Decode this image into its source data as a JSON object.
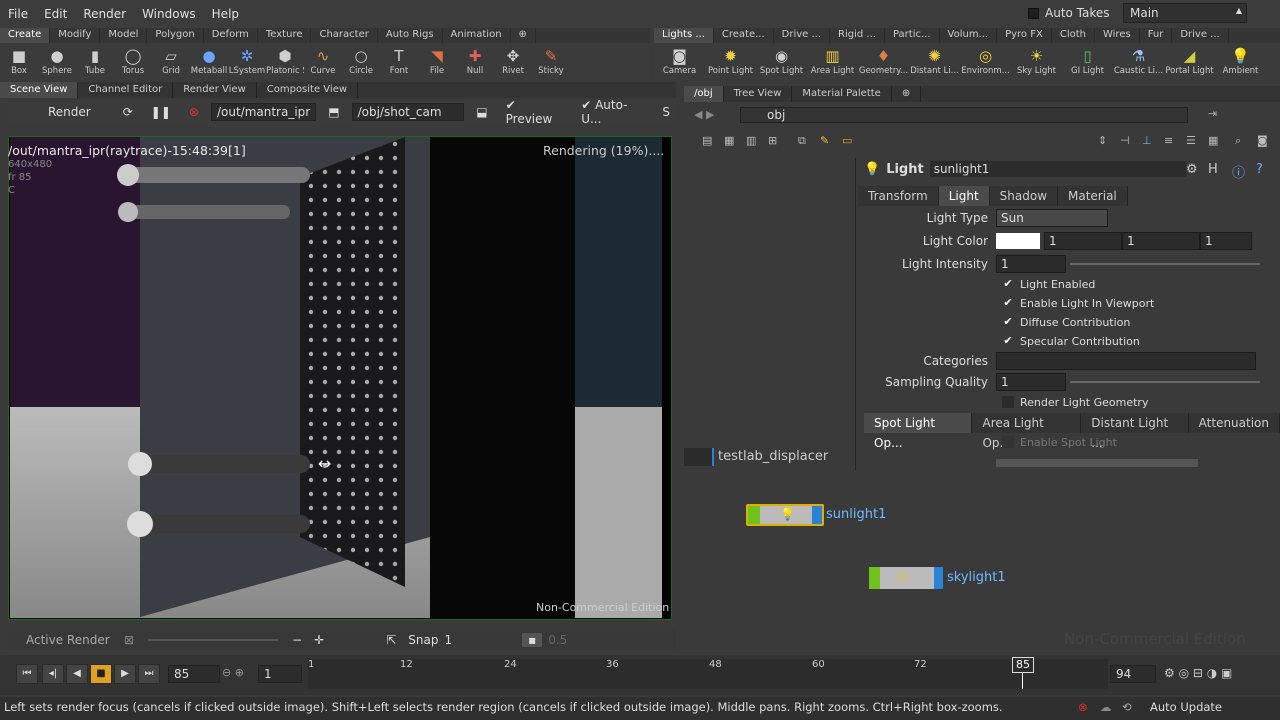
{
  "menubar": {
    "items": [
      "File",
      "Edit",
      "Render",
      "Windows",
      "Help"
    ],
    "auto_takes": "Auto Takes",
    "desktop": "Main"
  },
  "shelf_left": {
    "tabs": [
      "Create",
      "Modify",
      "Model",
      "Polygon",
      "Deform",
      "Texture",
      "Character",
      "Auto Rigs",
      "Animation"
    ],
    "tools": [
      "Box",
      "Sphere",
      "Tube",
      "Torus",
      "Grid",
      "Metaball",
      "LSystem",
      "Platonic S...",
      "Curve",
      "Circle",
      "Font",
      "File",
      "Null",
      "Rivet",
      "Sticky"
    ]
  },
  "shelf_right": {
    "tabs": [
      "Lights ...",
      "Create...",
      "Drive ...",
      "Rigid ...",
      "Partic...",
      "Volum...",
      "Pyro FX",
      "Cloth",
      "Wires",
      "Fur",
      "Drive ..."
    ],
    "tools": [
      "Camera",
      "Point Light",
      "Spot Light",
      "Area Light",
      "Geometry...",
      "Distant Li...",
      "Environm...",
      "Sky Light",
      "GI Light",
      "Caustic Li...",
      "Portal Light",
      "Ambient"
    ]
  },
  "left_tabs": [
    "Scene View",
    "Channel Editor",
    "Render View",
    "Composite View"
  ],
  "right_tabs": [
    "/obj",
    "Tree View",
    "Material Palette"
  ],
  "render_toolbar": {
    "render": "Render",
    "driver": "/out/mantra_ipr",
    "camera": "/obj/shot_cam",
    "preview": "Preview",
    "auto_update": "Auto-U...",
    "extra": "S"
  },
  "viewport": {
    "title": "/out/mantra_ipr(raytrace)-15:48:39[1]",
    "res": "640x480",
    "frame": "fr 85",
    "channel": "C",
    "status": "Rendering (19%)....",
    "watermark": "Non-Commercial Edition"
  },
  "viewer_bottom": {
    "active_render": "Active Render",
    "snap": "Snap",
    "snap_value": "1",
    "zoom": "0.5"
  },
  "path_bar": {
    "path": "obj"
  },
  "params": {
    "type": "Light",
    "name": "sunlight1",
    "tabs": [
      "Transform",
      "Light",
      "Shadow",
      "Material"
    ],
    "light_type_label": "Light Type",
    "light_type": "Sun",
    "light_color_label": "Light Color",
    "light_color": [
      "1",
      "1",
      "1"
    ],
    "intensity_label": "Light Intensity",
    "intensity": "1",
    "checks": [
      "Light Enabled",
      "Enable Light In Viewport",
      "Diffuse Contribution",
      "Specular Contribution"
    ],
    "categories_label": "Categories",
    "sampling_label": "Sampling Quality",
    "sampling": "1",
    "render_geo": "Render Light Geometry",
    "subtabs": [
      "Spot Light Op...",
      "Area Light Op...",
      "Distant Light ...",
      "Attenuation"
    ],
    "enable_spot": "Enable Spot Light"
  },
  "network": {
    "nodes": [
      "testlab_displacer",
      "sunlight1",
      "skylight1"
    ],
    "watermark": "Non-Commercial Edition"
  },
  "timeline": {
    "frame": "85",
    "step": "1",
    "ticks": [
      "1",
      "12",
      "24",
      "36",
      "48",
      "60",
      "72"
    ],
    "current": "85",
    "end": "94"
  },
  "status": {
    "message": "Left sets render focus (cancels if clicked outside image). Shift+Left selects render region (cancels if clicked outside image). Middle pans. Right zooms. Ctrl+Right box-zooms.",
    "auto_update": "Auto Update"
  },
  "colors": {
    "accent": "#e0b000",
    "node_blue": "#2a82d8",
    "node_green": "#6fc21c",
    "label_blue": "#6fb9ff"
  }
}
